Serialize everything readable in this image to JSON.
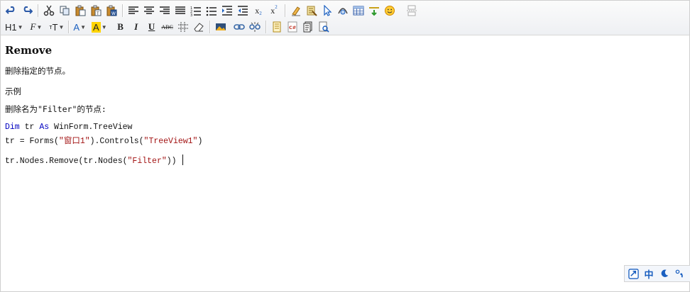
{
  "toolbar": {
    "row1": [
      "undo-icon",
      "redo-icon",
      "|",
      "cut-icon",
      "copy-icon",
      "paste-icon",
      "paste-text-icon",
      "paste-word-icon",
      "|",
      "align-left-icon",
      "align-center-icon",
      "align-right-icon",
      "align-justify-icon",
      "ordered-list-icon",
      "unordered-list-icon",
      "indent-icon",
      "outdent-icon",
      "subscript-icon",
      "superscript-icon",
      "|",
      "clear-format-icon",
      "select-all-icon",
      "cursor-icon",
      "image-map-icon",
      "table-icon",
      "insert-line-icon",
      "emoticon-icon",
      "page-break-icon"
    ],
    "heading_label": "H1",
    "font_label": "F",
    "size_label": "T",
    "bold": "B",
    "italic": "I",
    "underline": "U",
    "strike": "ABC",
    "subscript": "x",
    "subscript_small": "2",
    "superscript": "x",
    "superscript_small": "2",
    "color_font": "#1a5fc0",
    "color_highlight": "#ffd400"
  },
  "document": {
    "title": "Remove",
    "desc": "删除指定的节点。",
    "example_heading": "示例",
    "example_desc": "删除名为\"Filter\"的节点:",
    "code": {
      "line1_kw1": "Dim",
      "line1_mid": " tr ",
      "line1_kw2": "As",
      "line1_rest": " WinForm.TreeView",
      "line2_a": "tr = Forms(",
      "line2_str1": "\"窗口1\"",
      "line2_b": ").Controls(",
      "line2_str2": "\"TreeView1\"",
      "line2_c": ")",
      "line3_a": "tr.Nodes.Remove(tr.Nodes(",
      "line3_str": "\"Filter\"",
      "line3_b": "))"
    }
  },
  "status": {
    "mode_label": "中"
  }
}
